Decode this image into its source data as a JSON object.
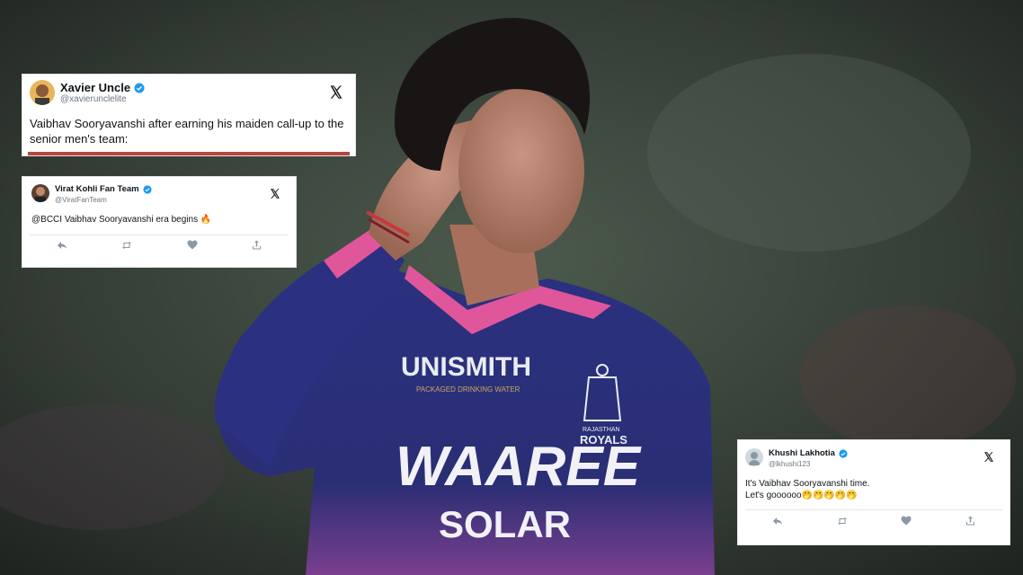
{
  "photo": {
    "jersey_brand_top": "UNISMITH",
    "jersey_brand_sub": "PACKAGED DRINKING WATER",
    "jersey_sponsor_line1": "WAAREE",
    "jersey_sponsor_line2": "SOLAR",
    "team_crest_line1": "RAJASTHAN",
    "team_crest_line2": "ROYALS"
  },
  "tweets": [
    {
      "name": "Xavier Uncle",
      "handle": "@xavierunclelite",
      "text": "Vaibhav Sooryavanshi after earning his maiden call-up to the senior men's team:",
      "verified_icon": "verified-badge-icon",
      "platform_icon": "x-logo-icon"
    },
    {
      "name": "Virat Kohli Fan Team",
      "handle": "@ViratFanTeam",
      "text": "@BCCI Vaibhav Sooryavanshi era begins 🔥",
      "verified_icon": "verified-badge-icon",
      "platform_icon": "x-logo-icon"
    },
    {
      "name": "Khushi Lakhotia",
      "handle": "@lkhushi123",
      "text": "It's Vaibhav Sooryavanshi time.\nLet's goooooo🤭🤭🤭🤭🤭",
      "verified_icon": "verified-badge-icon",
      "platform_icon": "x-logo-icon"
    }
  ],
  "colors": {
    "verified_blue": "#1d9bf0",
    "jersey_navy": "#2a3178",
    "jersey_pink": "#e0569a",
    "x_black": "#0f1419"
  }
}
